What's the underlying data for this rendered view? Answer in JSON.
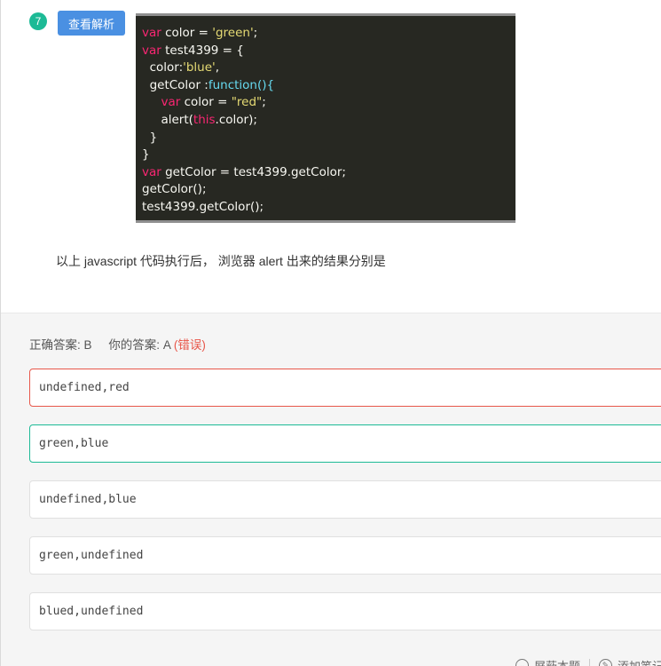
{
  "question": {
    "number": "7",
    "analysis_button": "查看解析",
    "prompt": "以上 javascript 代码执行后， 浏览器 alert 出来的结果分别是",
    "code_lines": [
      [
        {
          "t": "var",
          "c": "kw"
        },
        {
          "t": " color = "
        },
        {
          "t": "'green'",
          "c": "str"
        },
        {
          "t": ";"
        }
      ],
      [
        {
          "t": "var",
          "c": "kw"
        },
        {
          "t": " test4399 = {"
        }
      ],
      [
        {
          "t": "  color:"
        },
        {
          "t": "'blue'",
          "c": "str"
        },
        {
          "t": ","
        }
      ],
      [
        {
          "t": "  getColor :"
        },
        {
          "t": "function",
          "c": "fn"
        },
        {
          "t": "(){",
          "c": "fn"
        }
      ],
      [
        {
          "t": "     "
        },
        {
          "t": "var",
          "c": "kw"
        },
        {
          "t": " color = "
        },
        {
          "t": "\"red\"",
          "c": "str"
        },
        {
          "t": ";"
        }
      ],
      [
        {
          "t": "     alert("
        },
        {
          "t": "this",
          "c": "kw"
        },
        {
          "t": ".color);"
        }
      ],
      [
        {
          "t": "  }"
        }
      ],
      [
        {
          "t": "}"
        }
      ],
      [
        {
          "t": "var",
          "c": "kw"
        },
        {
          "t": " getColor = test4399.getColor;"
        }
      ],
      [
        {
          "t": "getColor();"
        }
      ],
      [
        {
          "t": "test4399.getColor();"
        }
      ]
    ]
  },
  "result": {
    "correct_label": "正确答案: B",
    "your_label": "你的答案: A",
    "status": "(错误)"
  },
  "options": [
    {
      "text": "undefined,red",
      "state": "chosen-wrong"
    },
    {
      "text": "green,blue",
      "state": "correct"
    },
    {
      "text": "undefined,blue",
      "state": ""
    },
    {
      "text": "green,undefined",
      "state": ""
    },
    {
      "text": "blued,undefined",
      "state": ""
    }
  ],
  "footer": {
    "block_label": "屏蔽本题",
    "add_note_label": "添加笔记"
  },
  "colors": {
    "accent_green": "#1dba96",
    "button_blue": "#4a90e2",
    "error_red": "#e8574a",
    "code_bg": "#272822"
  }
}
